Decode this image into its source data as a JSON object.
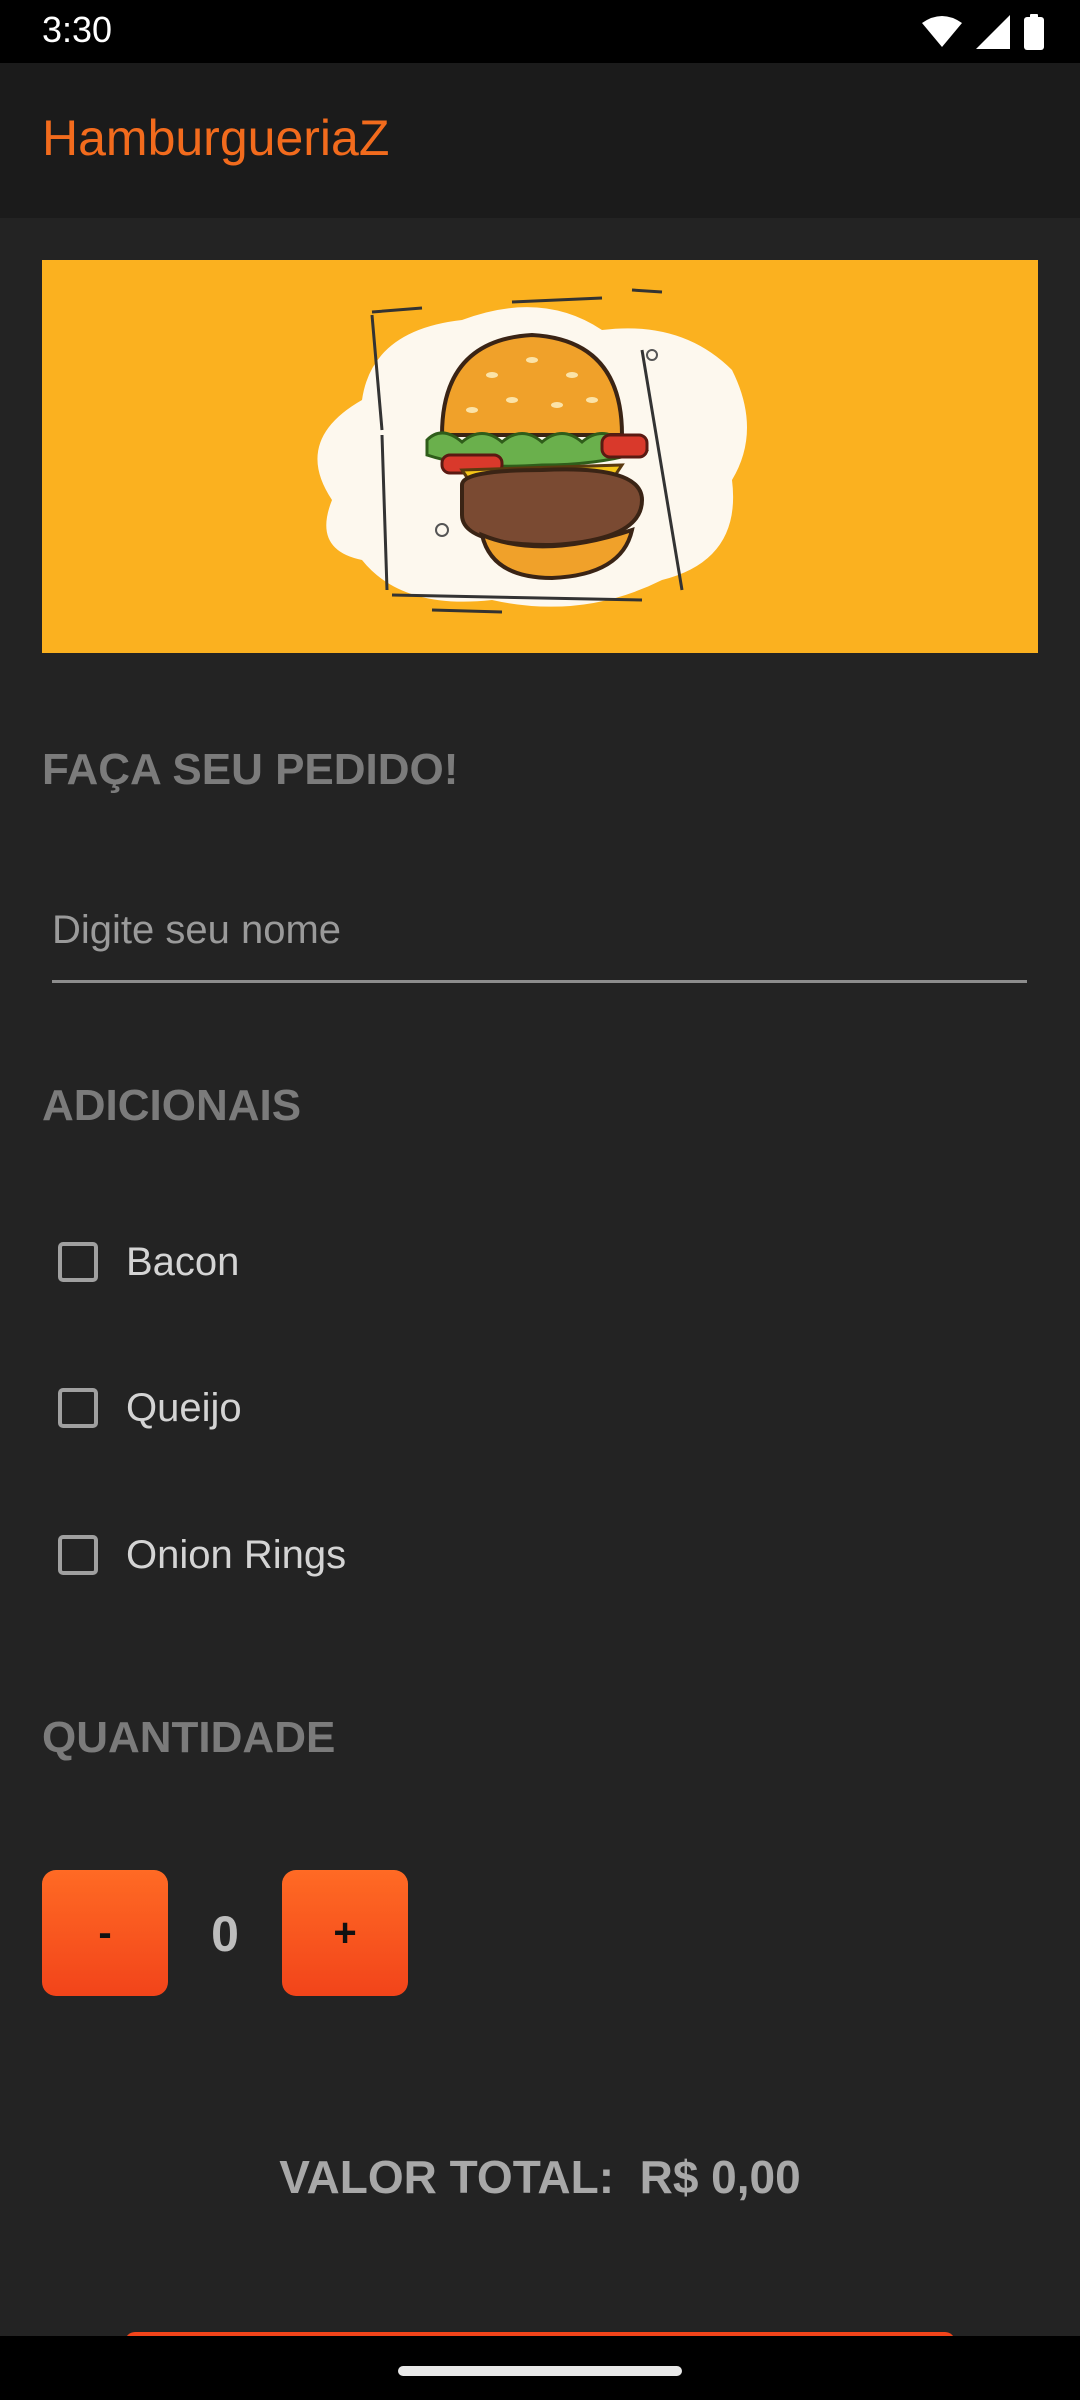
{
  "status_bar": {
    "time": "3:30",
    "icons": [
      "wifi-icon",
      "signal-icon",
      "battery-icon"
    ]
  },
  "app_bar": {
    "title": "HamburgueriaZ",
    "title_color": "#f26b1d"
  },
  "banner": {
    "image": "burger-illustration",
    "background_color": "#fbb11f"
  },
  "order_section": {
    "heading": "FAÇA SEU PEDIDO!",
    "name_placeholder": "Digite seu nome",
    "name_value": ""
  },
  "extras": {
    "heading": "ADICIONAIS",
    "items": [
      {
        "label": "Bacon",
        "checked": false
      },
      {
        "label": "Queijo",
        "checked": false
      },
      {
        "label": "Onion Rings",
        "checked": false
      }
    ]
  },
  "quantity": {
    "heading": "QUANTIDADE",
    "decrement_label": "-",
    "increment_label": "+",
    "value": "0",
    "button_color": "#f2441a"
  },
  "total": {
    "label": "VALOR TOTAL:",
    "value": "R$ 0,00"
  }
}
